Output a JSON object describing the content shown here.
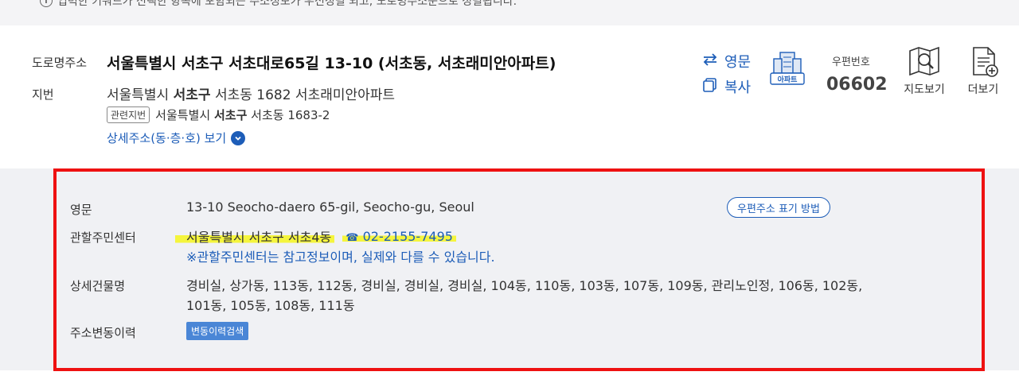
{
  "notice": {
    "text": "입력한 키워드가 선택한 항목에 포함되는 주소정보가 우선정렬 되고, 도로명주소순으로 정렬됩니다."
  },
  "result": {
    "road_label": "도로명주소",
    "road_address": "서울특별시 서초구 서초대로65길 13-10 (서초동, 서초래미안아파트)",
    "jibun_label": "지번",
    "jibun": {
      "prefix": "서울특별시",
      "gu": "서초구",
      "rest": "서초동 1682 서초래미안아파트"
    },
    "related": {
      "tag": "관련지번",
      "prefix": "서울특별시",
      "gu": "서초구",
      "rest": "서초동 1683-2"
    },
    "detail_link": "상세주소(동·층·호) 보기",
    "actions": {
      "english": "영문",
      "copy": "복사"
    },
    "building_tag": "아파트",
    "zip_label": "우편번호",
    "zip_value": "06602",
    "tools": {
      "map": "지도보기",
      "more": "더보기"
    }
  },
  "details": {
    "english_label": "영문",
    "english_value": "13-10 Seocho-daero 65-gil, Seocho-gu, Seoul",
    "zip_style_button": "우편주소 표기 방법",
    "center_label": "관할주민센터",
    "center_name": "서울특별시 서초구 서초4동",
    "center_phone": "02-2155-7495",
    "center_note": "※관할주민센터는 참고정보이며, 실제와 다를 수 있습니다.",
    "building_label": "상세건물명",
    "building_line1": "경비실, 상가동, 113동, 112동, 경비실, 경비실, 경비실, 104동, 110동, 103동, 107동, 109동, 관리노인정, 106동, 102동,",
    "building_line2": "101동, 105동, 108동, 111동",
    "history_label": "주소변동이력",
    "history_button": "변동이력검색"
  },
  "colors": {
    "accent": "#1d5db8",
    "highlight": "#f5f53d",
    "annotation": "#ee1111"
  }
}
